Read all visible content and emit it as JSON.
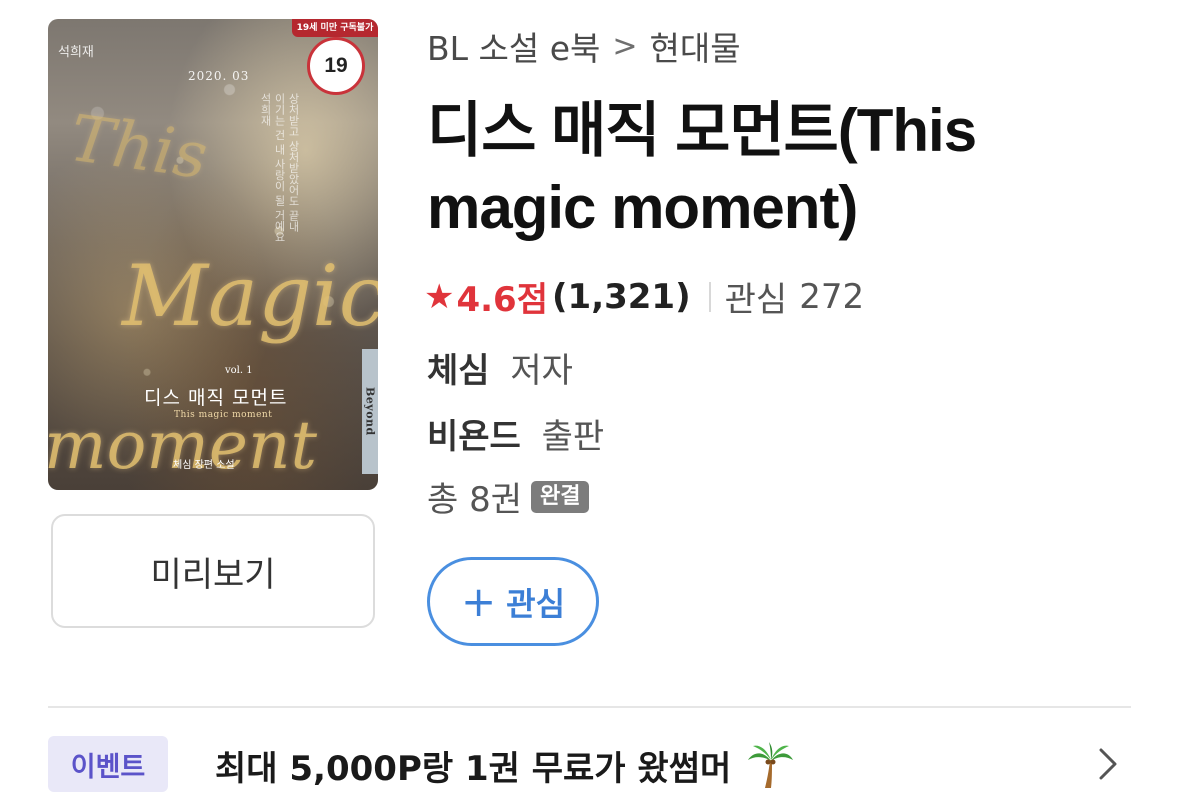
{
  "cover": {
    "adult_banner": "19세 미만 구독불가",
    "age_badge": "19",
    "author_top": "석희재",
    "date": "2020. 03",
    "script_this": "This",
    "script_magic": "Magic",
    "script_moment": "moment",
    "poem": "상처받고 상처받았어도 끝내 이기는 건 내 사랑이 될 거예요 석희재",
    "vol": "vol. 1",
    "title_kr": "디스 매직 모먼트",
    "title_en": "This magic moment",
    "author_bottom": "체심 장편 소설",
    "publisher_mark": "Beyond"
  },
  "preview_button": "미리보기",
  "breadcrumb": {
    "category": "BL 소설 e북",
    "separator": ">",
    "subcategory": "현대물"
  },
  "book": {
    "title": "디스 매직 모먼트(This magic moment)",
    "rating": "4.6점",
    "rating_count": "(1,321)",
    "favorites_label": "관심",
    "favorites_count": "272",
    "author": "체심",
    "author_role": "저자",
    "publisher": "비욘드",
    "publisher_role": "출판",
    "volumes": "총 8권",
    "status_badge": "완결"
  },
  "favorite_button": {
    "plus": "+",
    "label": "관심"
  },
  "event": {
    "badge": "이벤트",
    "text": "최대 5,000P랑 1권 무료가 왔썸머"
  },
  "icons": {
    "star": "star-icon",
    "palm": "palm-tree-icon",
    "chevron": "chevron-right-icon"
  },
  "colors": {
    "accent_red": "#e0343b",
    "accent_blue": "#3c7fd6",
    "event_purple": "#5b53c9",
    "badge_gray": "#7c7c7c"
  }
}
